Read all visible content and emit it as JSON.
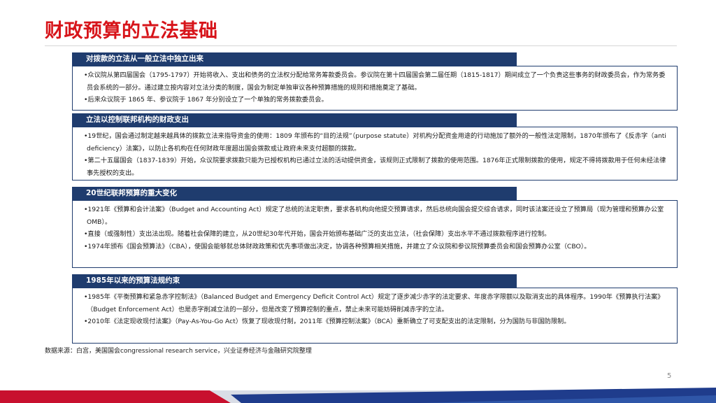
{
  "title": "财政预算的立法基础",
  "sections": [
    {
      "header": "对拨款的立法从一般立法中独立出来",
      "bullets": [
        "•众议院从第四届国会（1795-1797）开始将收入、支出和债务的立法权分配给常务筹款委员会。参议院在第十四届国会第二届任期（1815-1817）期间成立了一个负责这些事务的财政委员会，作为常务委员会系统的一部分。通过建立按内容对立法分类的制度，国会为制定单独审议各种预算措施的规则和措施奠定了基础。",
        "•后来众议院于 1865 年、参议院于 1867 年分别设立了一个单独的常务拨款委员会。"
      ]
    },
    {
      "header": "立法以控制联邦机构的财政支出",
      "bullets": [
        "•19世纪，国会通过制定越来越具体的拨款立法来指导资金的使用：1809 年颁布的“目的法规”（purpose statute）对机构分配资金用途的行动施加了额外的一般性法定限制，1870年颁布了《反赤字（anti deficiency）法案》，以防止各机构在任何财政年度超出国会拨款或让政府未来支付超额的拨款。",
        "•第二十五届国会（1837-1839）开始，众议院要求拨款只能为已授权机构已通过立法的活动提供资金，该规则正式限制了拨款的使用范围。1876年正式限制拨款的使用，规定不得将拨款用于任何未经法律事先授权的支出。"
      ]
    },
    {
      "header": "20世纪联邦预算的重大变化",
      "bullets": [
        "•1921年《预算和会计法案》（Budget and Accounting Act）规定了总统的法定职责，要求各机构向他提交预算请求，然后总统向国会提交综合请求，同时该法案还设立了预算局（现为管理和预算办公室OMB）。",
        "•直接（或强制性）支出法出现。随着社会保障的建立，从20世纪30年代开始，国会开始颁布基础广泛的支出立法，（社会保障）支出水平不通过拨款程序进行控制。",
        "•1974年颁布《国会预算法》（CBA），使国会能够就总体财政政策和优先事项做出决定，协调各种预算相关措施，并建立了众议院和参议院预算委员会和国会预算办公室（CBO）。"
      ]
    },
    {
      "header": "1985年以来的预算法规约束",
      "bullets": [
        "•1985年《平衡预算和紧急赤字控制法》（Balanced Budget and Emergency Deficit Control Act）规定了逐步减少赤字的法定要求、年度赤字限额以及取消支出的具体程序。1990年《预算执行法案》（Budget Enforcement Act）也是赤字削减立法的一部分，但是改变了预算控制的重点，禁止未来可能妨碍削减赤字的立法。",
        "•2010年《法定现收现付法案》（Pay-As-You-Go Act）恢复了现收现付制，2011年《预算控制法案》（BCA）重新确立了可支配支出的法定限制，分为国防与非国防限制。"
      ]
    }
  ],
  "source": "数据来源：白宫，美国国会congressional research service，兴业证券经济与金融研究院整理",
  "page_number": "5",
  "colors": {
    "title_red": "#d7141a",
    "header_navy": "#1f3c6e",
    "footer_red": "#c8102e",
    "footer_blue": "#1f3c8c"
  }
}
